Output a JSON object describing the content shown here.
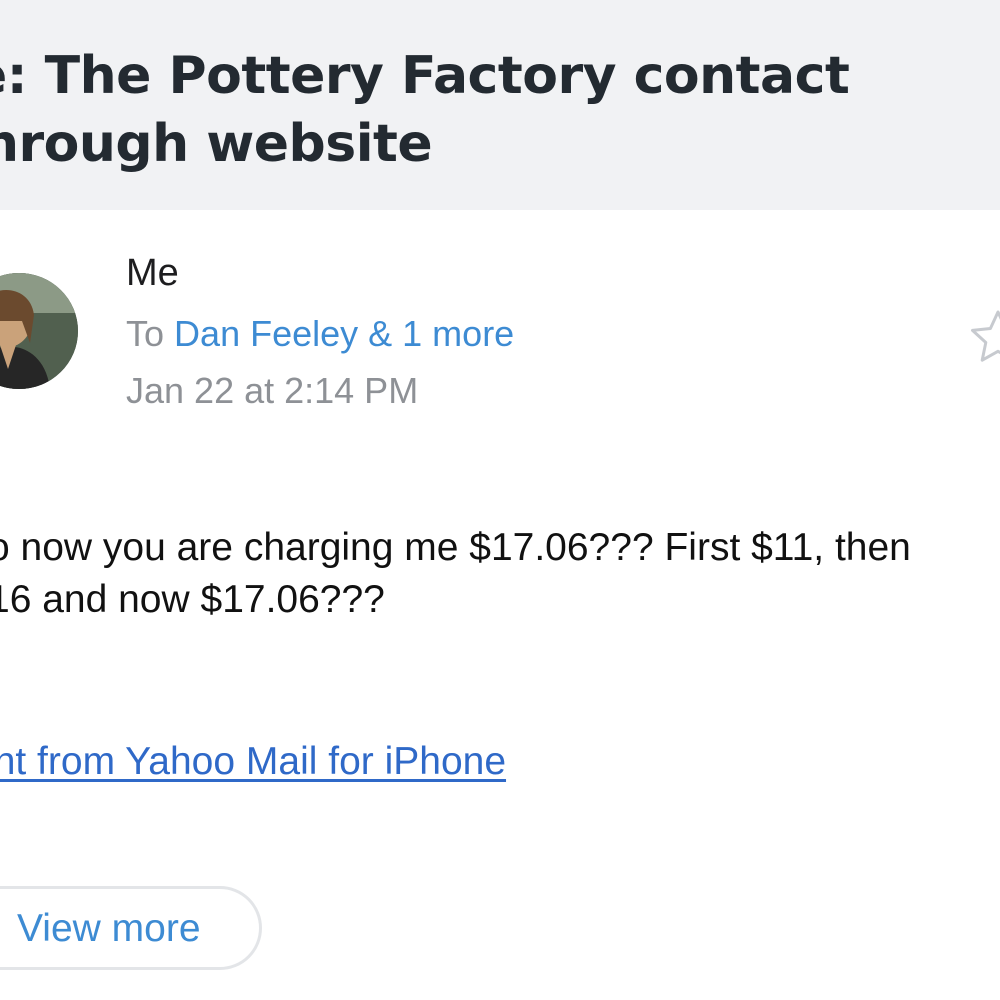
{
  "header": {
    "subject_line_1": "e: The Pottery Factory contact",
    "subject_line_2": "hrough website"
  },
  "sender": {
    "name": "Me",
    "to_prefix": "To",
    "recipients": "Dan Feeley & 1 more",
    "date": "Jan 22 at 2:14 PM",
    "avatar_icon": "profile-photo"
  },
  "actions": {
    "star_icon": "star-outline-icon"
  },
  "message": {
    "lines": [
      "o now you are charging me $17.06??? First $11, then",
      "16 and now $17.06???"
    ],
    "signature": "ent from Yahoo Mail for iPhone"
  },
  "footer": {
    "view_more_label": "View more"
  },
  "colors": {
    "header_bg": "#f1f2f4",
    "link": "#3d8bd3",
    "signature_link": "#2f69c8",
    "meta_text": "#8e9196"
  }
}
